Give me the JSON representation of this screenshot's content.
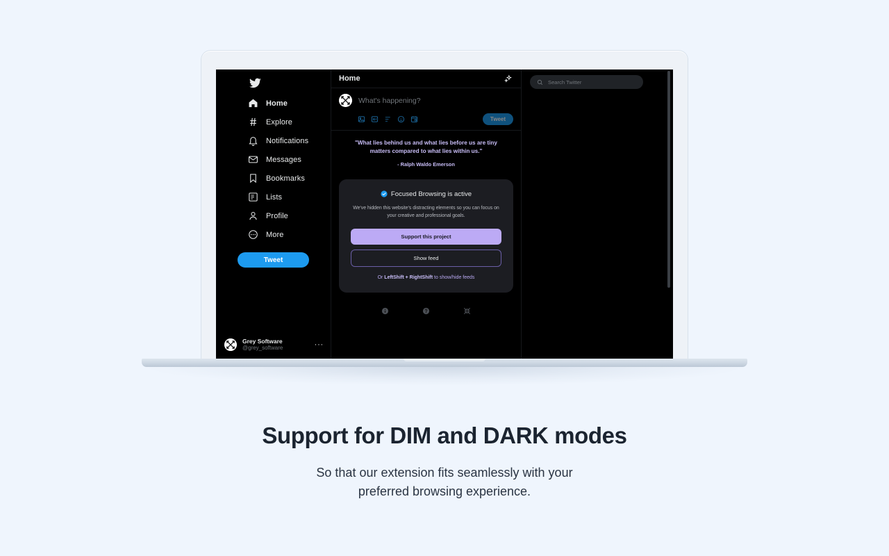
{
  "page": {
    "background_color": "#eff5fd",
    "caption_title": "Support for DIM and DARK modes",
    "caption_subtitle_line1": "So that our extension fits seamlessly with your",
    "caption_subtitle_line2": "preferred browsing experience."
  },
  "colors": {
    "twitter_blue": "#1d9bf0",
    "accent_purple": "#bcaaf5",
    "quote_purple": "#c8bdf7",
    "app_background": "#000000",
    "card_background": "#1c1d22",
    "muted_text": "#71767b"
  },
  "sidebar": {
    "logo_icon": "twitter-bird-icon",
    "items": [
      {
        "label": "Home",
        "icon": "home-icon",
        "active": true
      },
      {
        "label": "Explore",
        "icon": "hashtag-icon",
        "active": false
      },
      {
        "label": "Notifications",
        "icon": "bell-icon",
        "active": false
      },
      {
        "label": "Messages",
        "icon": "envelope-icon",
        "active": false
      },
      {
        "label": "Bookmarks",
        "icon": "bookmark-icon",
        "active": false
      },
      {
        "label": "Lists",
        "icon": "list-icon",
        "active": false
      },
      {
        "label": "Profile",
        "icon": "person-icon",
        "active": false
      },
      {
        "label": "More",
        "icon": "more-circle-icon",
        "active": false
      }
    ],
    "tweet_button_label": "Tweet",
    "profile": {
      "name": "Grey Software",
      "handle": "@grey_software",
      "avatar_icon": "grey-software-logo",
      "menu_icon": "ellipsis-icon"
    }
  },
  "main": {
    "header_title": "Home",
    "header_action_icon": "sparkle-icon",
    "composer": {
      "avatar_icon": "grey-software-logo",
      "placeholder": "What's happening?",
      "tweet_button_label": "Tweet",
      "action_icons": [
        "image-icon",
        "gif-icon",
        "poll-icon",
        "emoji-icon",
        "schedule-icon"
      ]
    },
    "quote": {
      "text": "\"What lies behind us and what lies before us are tiny matters compared to what lies within us.\"",
      "author": "- Ralph Waldo Emerson"
    },
    "focus_card": {
      "badge_icon": "verified-check-icon",
      "title": "Focused Browsing is active",
      "description": "We've hidden this website's distracting elements so you can focus on your creative and professional goals.",
      "primary_button_label": "Support this project",
      "secondary_button_label": "Show feed",
      "hint_prefix": "Or ",
      "hint_keys": "LeftShift + RightShift",
      "hint_suffix": " to show/hide feeds"
    },
    "footer_icons": [
      "info-icon",
      "help-icon",
      "collapse-arrows-icon"
    ]
  },
  "rightbar": {
    "search": {
      "icon": "search-icon",
      "placeholder": "Search Twitter",
      "value": ""
    },
    "scrollbar_icon": "vertical-scrollbar"
  }
}
